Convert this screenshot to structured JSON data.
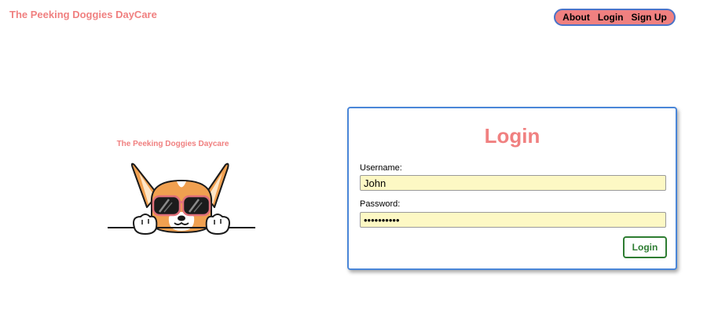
{
  "header": {
    "brand": "The Peeking Doggies DayCare",
    "nav": {
      "about": "About",
      "login": "Login",
      "signup": "Sign Up"
    }
  },
  "hero": {
    "title": "The Peeking Doggies Daycare",
    "image_icon": "corgi-sunglasses-illustration"
  },
  "login_form": {
    "title": "Login",
    "username_label": "Username:",
    "username_value": "John",
    "password_label": "Password:",
    "password_value": "••••••••••",
    "submit_label": "Login"
  },
  "colors": {
    "brand": "#f08080",
    "nav_border": "#4a73c8",
    "card_border": "#4a86d8",
    "input_bg": "#fdf8c4",
    "button": "#2e7d32"
  }
}
